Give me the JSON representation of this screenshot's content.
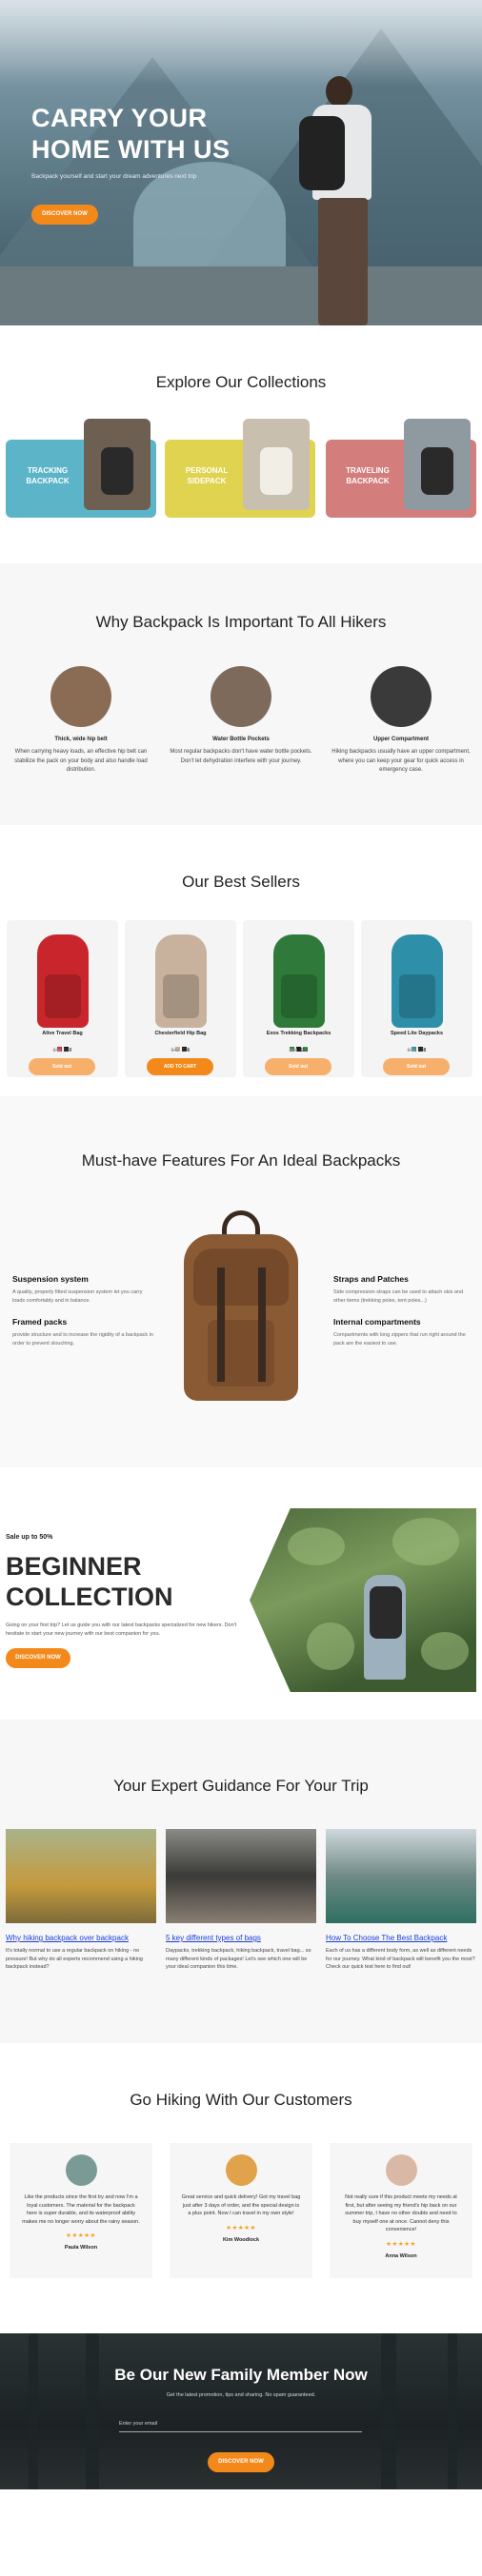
{
  "hero": {
    "title": "CARRY YOUR HOME WITH US",
    "subtitle": "Backpack yourself and start your dream adventures next trip",
    "cta": "DISCOVER NOW"
  },
  "collections": {
    "title": "Explore Our Collections",
    "items": [
      {
        "label": "TRACKING BACKPACK"
      },
      {
        "label": "PERSONAL SIDEPACK"
      },
      {
        "label": "TRAVELING BACKPACK"
      }
    ]
  },
  "why": {
    "title": "Why Backpack Is Important To All Hikers",
    "items": [
      {
        "title": "Thick, wide hip belt",
        "desc": "When carrying heavy loads, an effective hip belt can stabilize the pack on your body and also handle load distribution."
      },
      {
        "title": "Water Bottle Pockets",
        "desc": "Most regular backpacks don't have water bottle pockets. Don't let dehydration interfere with your journey."
      },
      {
        "title": "Upper Compartment",
        "desc": "Hiking backpacks usually have an upper compartment, where you can keep your gear for quick access in emergency case."
      }
    ]
  },
  "best": {
    "title": "Our Best Sellers",
    "products": [
      {
        "name": "Alive Travel Bag",
        "old": "$48",
        "price": "$40",
        "btn": "Sold out",
        "color": "#c8262c",
        "swatches": [
          "#c8262c",
          "#1a1a1a"
        ]
      },
      {
        "name": "Chesterfield Hip Bag",
        "old": "$42",
        "price": "$36",
        "btn": "ADD TO CART",
        "color": "#c8b29e",
        "swatches": [
          "#c8b29e",
          "#1a1a1a"
        ]
      },
      {
        "name": "Exos Trekking Backpacks",
        "old": "$60",
        "price": "$50",
        "btn": "Sold out",
        "color": "#2f7a3a",
        "swatches": [
          "#2f7a3a",
          "#1a1a1a",
          "#3fa14b"
        ]
      },
      {
        "name": "Speed Lite Daypacks",
        "old": "$45",
        "price": "$38",
        "btn": "Sold out",
        "color": "#2d8fa8",
        "swatches": [
          "#2d8fa8",
          "#1a1a1a"
        ]
      }
    ]
  },
  "features": {
    "title": "Must-have Features For An Ideal Backpacks",
    "left": [
      {
        "title": "Suspension system",
        "desc": "A quality, properly fitted suspension system let you carry loads comfortably and in balance."
      },
      {
        "title": "Framed packs",
        "desc": "provide structure and to increase the rigidity of a backpack in order to prevent slouching."
      }
    ],
    "right": [
      {
        "title": "Straps and Patches",
        "desc": "Side compression straps can be used to attach skis and other items (trekking poles, tent poles...)"
      },
      {
        "title": "Internal compartments",
        "desc": "Compartments with long zippers that run right around the pack are the easiest to use."
      }
    ]
  },
  "beginner": {
    "pre": "Sale up to 50%",
    "title": "BEGINNER COLLECTION",
    "desc": "Going on your first trip? Let us guide you with our latest backpacks specialized for new hikers. Don't hesitate to start your new journey with our best companion for you.",
    "cta": "DISCOVER NOW"
  },
  "guide": {
    "title": "Your Expert Guidance For Your Trip",
    "posts": [
      {
        "title": "Why hiking backpack over backpack",
        "desc": "It's totally normal to use a regular backpack on hiking - no pressure! But why do all experts recommend using a hiking backpack instead?"
      },
      {
        "title": "5 key different types of bags",
        "desc": "Daypacks, trekking backpack, hiking backpack, travel bag... so many different kinds of packages! Let's see which one will be your ideal companion this time."
      },
      {
        "title": "How To Choose The Best Backpack",
        "desc": "Each of us has a different body form, as well as different needs for our journey. What kind of backpack will benefit you the most? Check our quick test here to find out!"
      }
    ]
  },
  "testimonials": {
    "title": "Go Hiking With Our Customers",
    "items": [
      {
        "quote": "Like the products since the first try and now I'm a loyal customers. The material for the backpack here is super durable, and its waterproof ability makes me no longer worry about the rainy season.",
        "stars": "★★★★★",
        "name": "Paula Wilson"
      },
      {
        "quote": "Great service and quick delivery! Got my travel bag just after 3 days of order, and the special design is a plus point. Now I can travel in my own style!",
        "stars": "★★★★★",
        "name": "Kim Woodlock"
      },
      {
        "quote": "Not really sure if this product meets my needs at first, but after seeing my friend's hip back on our summer trip, I have no other doubts and need to buy myself one at once. Cannot deny this convenience!",
        "stars": "★★★★★",
        "name": "Anna Wilson"
      }
    ]
  },
  "newsletter": {
    "title": "Be Our New Family Member Now",
    "subtitle": "Get the latest promotion, tips and sharing. No spam guaranteed.",
    "placeholder": "Enter your email",
    "cta": "DISCOVER NOW"
  },
  "colors": {
    "accent": "#f2891a",
    "tracking": "#5cb4c9",
    "personal": "#e0d34f",
    "traveling": "#d37d7d"
  }
}
